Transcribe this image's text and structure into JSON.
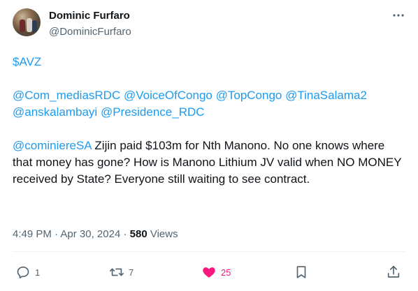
{
  "author": {
    "name": "Dominic Furfaro",
    "handle": "@DominicFurfaro"
  },
  "tweet": {
    "cashtag": "$AVZ",
    "mentions_line1": [
      "@Com_mediasRDC",
      "@VoiceOfCongo",
      "@TopCongo",
      "@TinaSalama2"
    ],
    "mentions_line2": [
      "@anskalambayi",
      "@Presidence_RDC"
    ],
    "reply_mention": "@cominiereSA",
    "body_text": " Zijin paid $103m for Nth Manono. No one knows where that money has gone? How is Manono Lithium JV valid when NO MONEY received by State? Everyone still waiting to see contract."
  },
  "meta": {
    "time": "4:49 PM",
    "sep1": " · ",
    "date": "Apr 30, 2024",
    "sep2": " · ",
    "views_count": "580",
    "views_label": " Views"
  },
  "actions": {
    "replies": "1",
    "retweets": "7",
    "likes": "25"
  },
  "colors": {
    "link": "#1d9bf0",
    "like": "#f91880",
    "muted": "#536471",
    "text": "#0f1419"
  },
  "icons": {
    "more": "more-horizontal-icon",
    "reply": "reply-icon",
    "retweet": "retweet-icon",
    "like": "heart-filled-icon",
    "bookmark": "bookmark-icon",
    "share": "share-icon"
  }
}
